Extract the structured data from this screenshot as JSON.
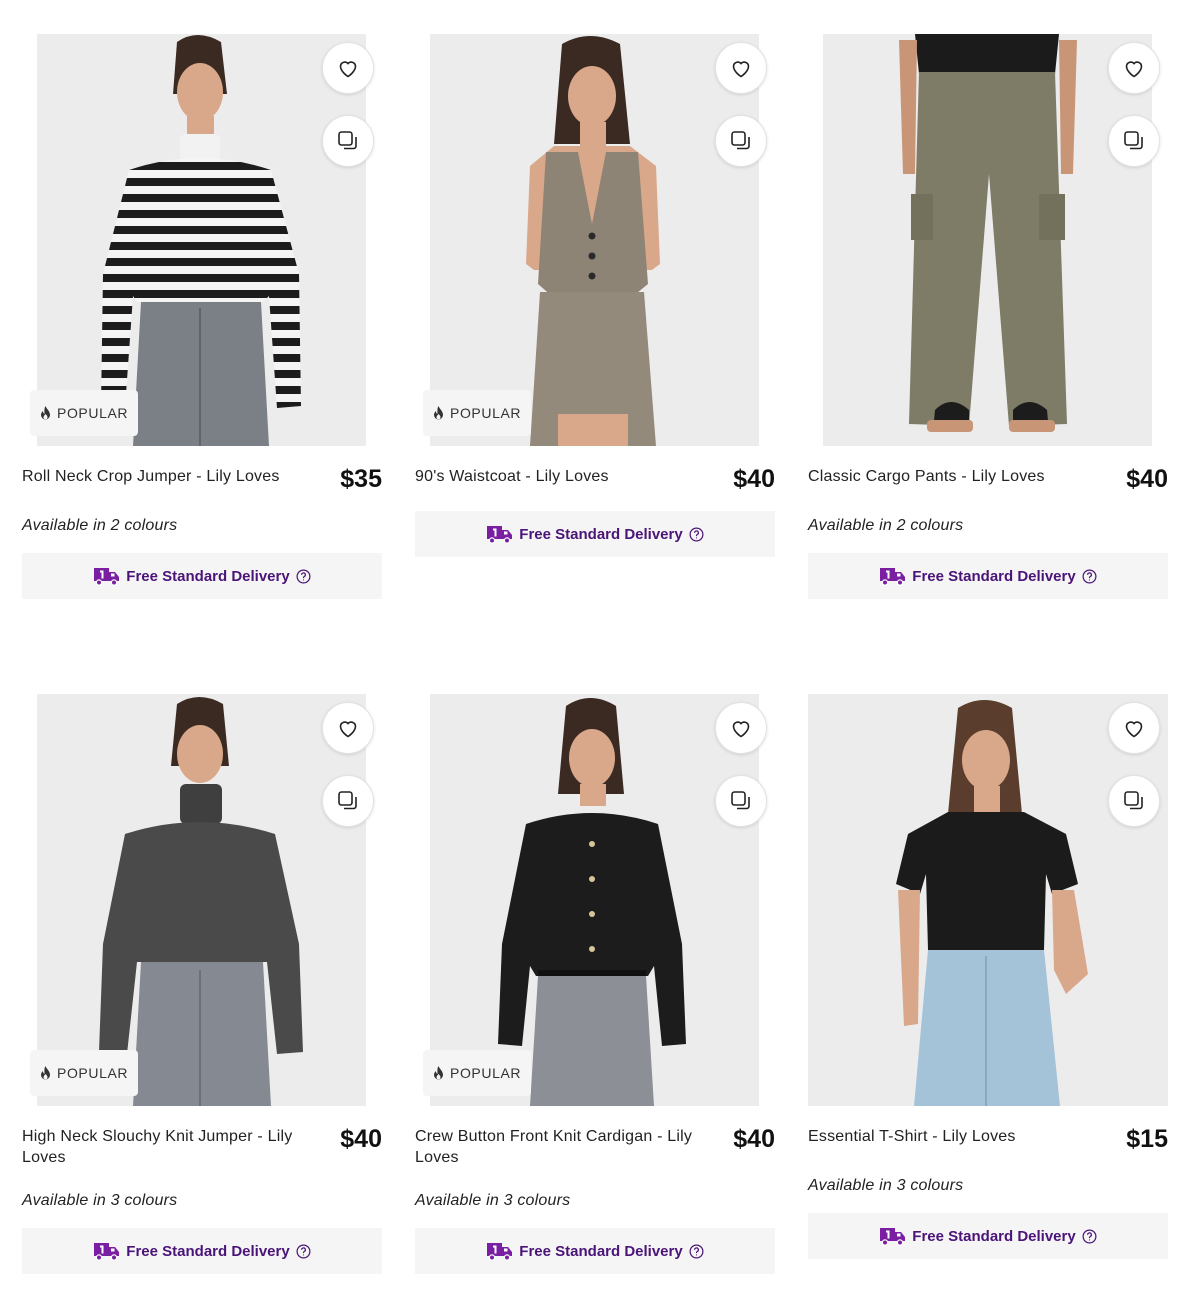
{
  "colors": {
    "accent_purple": "#4a1478",
    "truck_purple": "#7a1fa2",
    "badge_bg": "#f5f5f5"
  },
  "icons": {
    "wishlist": "heart-icon",
    "compare": "compare-icon",
    "popular": "flame-icon",
    "delivery": "delivery-truck-icon",
    "help": "help-circle-icon"
  },
  "products": [
    {
      "title": "Roll Neck Crop Jumper - Lily Loves",
      "price": "$35",
      "badge": "POPULAR",
      "colours": "Available in 2 colours",
      "delivery": "Free Standard Delivery"
    },
    {
      "title": "90's Waistcoat - Lily Loves",
      "price": "$40",
      "badge": "POPULAR",
      "delivery": "Free Standard Delivery"
    },
    {
      "title": "Classic Cargo Pants - Lily Loves",
      "price": "$40",
      "colours": "Available in 2 colours",
      "delivery": "Free Standard Delivery"
    },
    {
      "title": "High Neck Slouchy Knit Jumper - Lily Loves",
      "price": "$40",
      "badge": "POPULAR",
      "colours": "Available in 3 colours",
      "delivery": "Free Standard Delivery"
    },
    {
      "title": "Crew Button Front Knit Cardigan - Lily Loves",
      "price": "$40",
      "badge": "POPULAR",
      "colours": "Available in 3 colours",
      "delivery": "Free Standard Delivery"
    },
    {
      "title": "Essential T-Shirt - Lily Loves",
      "price": "$15",
      "colours": "Available in 3 colours",
      "delivery": "Free Standard Delivery"
    }
  ]
}
